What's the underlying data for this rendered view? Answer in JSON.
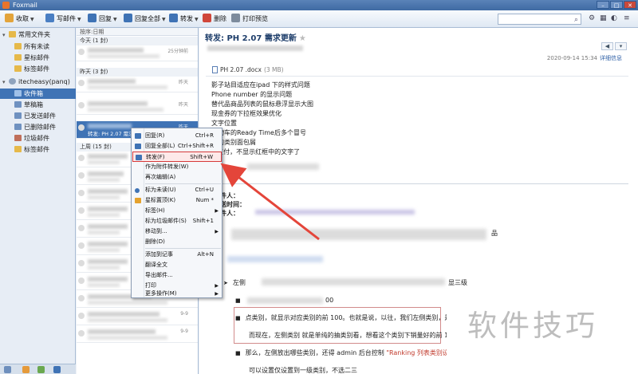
{
  "window": {
    "title": "Foxmail"
  },
  "toolbar": {
    "receive": "收取",
    "compose": "写邮件",
    "reply": "回复",
    "reply_all": "回复全部",
    "forward": "转发",
    "delete": "删除",
    "print_preview": "打印预览",
    "search_placeholder": ""
  },
  "sidebar": {
    "group_common": "常用文件夹",
    "all_unread": "所有未读",
    "starred": "星标邮件",
    "tagged": "标签邮件",
    "account": "itecheasy(panq)",
    "inbox": "收件箱",
    "drafts": "草稿箱",
    "sent": "已发送邮件",
    "deleted": "已删除邮件",
    "junk": "垃圾邮件",
    "tagged2": "标签邮件"
  },
  "list": {
    "sort": "按序:日期",
    "today_group": "今天 (1 封)",
    "yesterday_group": "昨天 (3 封)",
    "lastweek_group": "上周 (15 封)",
    "rows": [
      {
        "date": "25分钟前"
      },
      {
        "date": "昨天"
      },
      {
        "date": "昨天"
      },
      {
        "date": "昨天",
        "subject": "转发: PH 2.07 需求..."
      },
      {
        "date": ""
      },
      {
        "date": ""
      },
      {
        "date": ""
      },
      {
        "date": ""
      },
      {
        "date": ""
      },
      {
        "date": ""
      },
      {
        "date": ""
      },
      {
        "date": ""
      },
      {
        "date": "9-9"
      },
      {
        "date": "9-9"
      },
      {
        "date": "9-9"
      }
    ]
  },
  "mail": {
    "subject": "转发: PH 2.07 需求更新",
    "datetime": "2020-09-14 15:34",
    "detail_link": "详细信息",
    "attachment_name": "PH 2.07 .docx",
    "attachment_size": "(3 MB)",
    "lines": [
      "影子站目适应在ipad 下的样式问题",
      "Phone number 的显示问题",
      "替代品商品列表的鼠标悬浮显示大图",
      "现金券的下拉框效果优化",
      "文字位置",
      "购物车的Ready Time后多个冒号",
      "结的类别面包屑",
      "al支付，不显示红框中的文字了"
    ],
    "hdr_from": "件人：",
    "hdr_time": "送时间：",
    "hdr_to": "件人：",
    "ext_text": "品",
    "para_left": "左侧",
    "para_left_end": "显三级",
    "b1_end": "00",
    "b2": "点类别，就显示对应类别的前 100。也就是说，以往，我们左侧类别，是对右侧商",
    "b2_next": "而现在，左侧类别 就是单纯的抽类别看，想看这个类别下销量好的前 100 商品",
    "b3": "那么，左侧放出哪些类别，还得 admin 后台控制",
    "b3_kw": "\"Ranking 列表类别设置 \"",
    "b4": "可以设置仅设置到一级类别，不选二三"
  },
  "context_menu": {
    "items": [
      {
        "label": "回复(R)",
        "shortcut": "Ctrl+R"
      },
      {
        "label": "回复全部(L)",
        "shortcut": "Ctrl+Shift+R"
      },
      {
        "label": "转发(F)",
        "shortcut": "Shift+W"
      },
      {
        "label": "作为附件转发(W)",
        "shortcut": ""
      },
      {
        "label": "再次编辑(A)",
        "shortcut": ""
      },
      {
        "label": "标为未读(U)",
        "shortcut": "Ctrl+U"
      },
      {
        "label": "星标置顶(K)",
        "shortcut": "Num *"
      },
      {
        "label": "标签(H)",
        "shortcut": ""
      },
      {
        "label": "标为垃圾邮件(S)",
        "shortcut": "Shift+1"
      },
      {
        "label": "移动到...",
        "shortcut": ""
      },
      {
        "label": "删除(D)",
        "shortcut": ""
      },
      {
        "label": "添加到记事",
        "shortcut": "Alt+N"
      },
      {
        "label": "翻译全文",
        "shortcut": ""
      },
      {
        "label": "导出邮件...",
        "shortcut": ""
      },
      {
        "label": "打印",
        "shortcut": ""
      },
      {
        "label": "更多操作(M)",
        "shortcut": ""
      }
    ]
  },
  "watermark": "软件技巧",
  "colors": {
    "accent": "#3f73b5",
    "highlight": "#d63a3a",
    "arrow": "#e4453a"
  }
}
